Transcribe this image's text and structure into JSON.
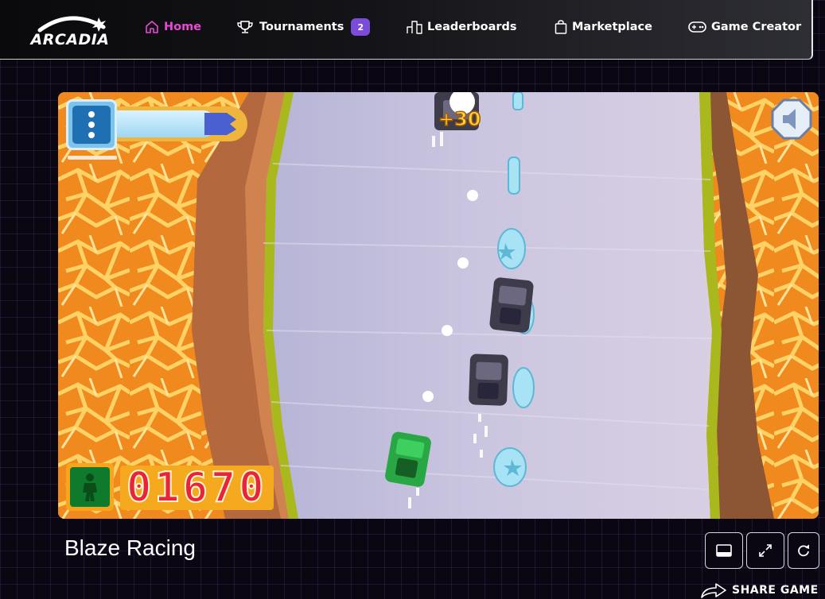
{
  "brand": {
    "logo_text": "ARCADIA"
  },
  "nav": {
    "items": [
      {
        "label": "Home",
        "icon": "home-icon",
        "active": true
      },
      {
        "label": "Tournaments",
        "icon": "trophy-icon",
        "badge": "2"
      },
      {
        "label": "Leaderboards",
        "icon": "podium-icon"
      },
      {
        "label": "Marketplace",
        "icon": "shopping-bag-icon"
      },
      {
        "label": "Game Creator",
        "icon": "gamepad-icon"
      }
    ]
  },
  "game": {
    "title": "Blaze Racing",
    "hud": {
      "score": "01670",
      "bonus": "+30",
      "menu_icon": "three-dots-icon",
      "sound_icon": "speaker-icon",
      "player_icon": "player-silhouette-icon",
      "boost_level": 0.75
    }
  },
  "controls": {
    "buttons": [
      {
        "name": "theater-mode-button",
        "icon": "theater-icon"
      },
      {
        "name": "fullscreen-button",
        "icon": "expand-icon"
      },
      {
        "name": "restart-button",
        "icon": "reload-icon"
      }
    ],
    "share_label": "SHARE GAME"
  },
  "colors": {
    "active_nav": "#e84ad6",
    "badge": "#7b4bd9",
    "lava": "#f08a1e",
    "road": "#c9c4df"
  }
}
